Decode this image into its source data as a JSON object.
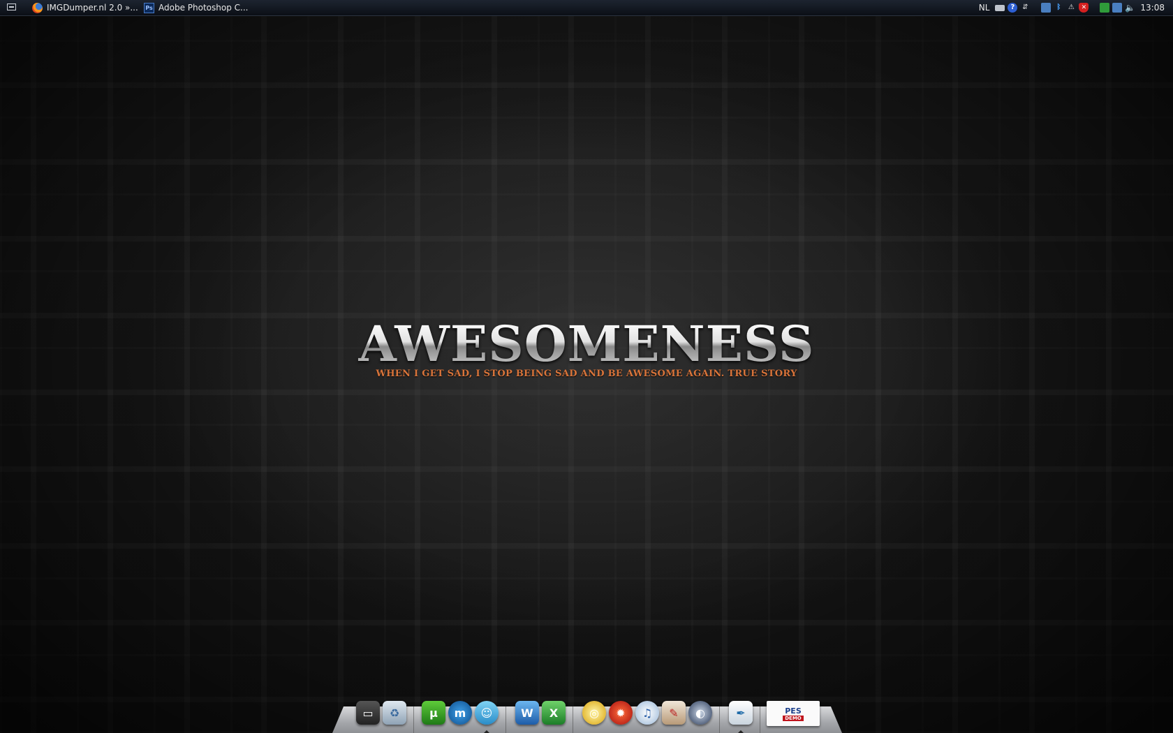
{
  "taskbar": {
    "tasks": [
      {
        "label": "IMGDumper.nl 2.0 »...",
        "icon": "firefox-icon"
      },
      {
        "label": "Adobe Photoshop C...",
        "icon": "photoshop-icon"
      }
    ],
    "tray": {
      "language": "NL",
      "clock": "13:08"
    }
  },
  "wallpaper": {
    "title": "AWESOMENESS",
    "tagline": "WHEN I GET SAD, I STOP BEING SAD AND BE AWESOME AGAIN. TRUE STORY"
  },
  "dock": {
    "items": [
      {
        "name": "computer-icon"
      },
      {
        "name": "recycle-bin-icon"
      },
      {
        "name": "utorrent-icon",
        "glyph": "µ"
      },
      {
        "name": "maxthon-icon",
        "glyph": "m"
      },
      {
        "name": "messenger-icon"
      },
      {
        "name": "word-icon",
        "glyph": "W"
      },
      {
        "name": "excel-icon",
        "glyph": "X"
      },
      {
        "name": "dvd-icon"
      },
      {
        "name": "burner-icon"
      },
      {
        "name": "itunes-icon",
        "glyph": "♫"
      },
      {
        "name": "paint-icon"
      },
      {
        "name": "globe-icon"
      },
      {
        "name": "notepad-quill-icon"
      },
      {
        "name": "pes-demo-icon",
        "glyph": "PES"
      }
    ],
    "pes_caption": "DEMO"
  },
  "colors": {
    "taskbar": "#0b0f16",
    "tagline": "#d9743a",
    "dock": "#a5a7ab"
  }
}
